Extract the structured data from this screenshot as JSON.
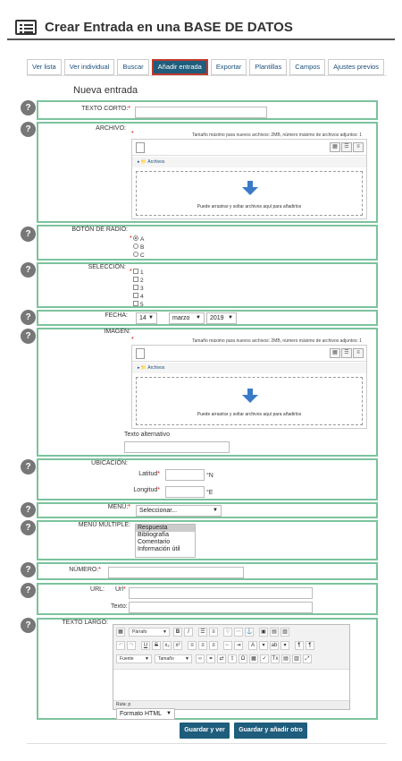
{
  "header": {
    "title": "Crear Entrada en una BASE DE DATOS",
    "icon": "list-icon"
  },
  "tabs": [
    {
      "label": "Ver lista",
      "active": false
    },
    {
      "label": "Ver individual",
      "active": false
    },
    {
      "label": "Buscar",
      "active": false
    },
    {
      "label": "Añadir entrada",
      "active": true
    },
    {
      "label": "Exportar",
      "active": false
    },
    {
      "label": "Plantillas",
      "active": false
    },
    {
      "label": "Campos",
      "active": false
    },
    {
      "label": "Ajustes previos",
      "active": false
    }
  ],
  "section_title": "Nueva entrada",
  "help_glyph": "?",
  "required_mark": "*",
  "fields": {
    "texto_corto": {
      "label": "TEXTO CORTO:",
      "value": ""
    },
    "archivo": {
      "label": "ARCHIVO:",
      "note": "Tamaño máximo para nuevos archivos: 2MB, número máximo de archivos adjuntos: 1",
      "path": "Archivos",
      "drop_text": "Puede arrastrar y soltar archivos aquí para añadirlos"
    },
    "boton_radio": {
      "label": "BOTÓN DE RADIO:",
      "options": [
        "A",
        "B",
        "C"
      ],
      "selected": "A"
    },
    "seleccion": {
      "label": "SELECCIÓN:",
      "options": [
        "1",
        "2",
        "3",
        "4",
        "5"
      ]
    },
    "fecha": {
      "label": "FECHA:",
      "day": "14",
      "month": "marzo",
      "year": "2019"
    },
    "imagen": {
      "label": "IMAGEN:",
      "note": "Tamaño máximo para nuevos archivos: 2MB, número máximo de archivos adjuntos: 1",
      "path": "Archivos",
      "drop_text": "Puede arrastrar y soltar archivos aquí para añadirlos",
      "alt_label": "Texto alternativo",
      "alt_value": ""
    },
    "ubicacion": {
      "label": "UBICACIÓN:",
      "lat_label": "Latitud",
      "lat_unit": "°N",
      "lon_label": "Longitud",
      "lon_unit": "°E"
    },
    "menu": {
      "label": "MENÚ:",
      "selected": "Seleccionar..."
    },
    "menu_multiple": {
      "label": "MENÚ MÚLTIPLE:",
      "options": [
        "Respuesta",
        "Bibliografía",
        "Comentario",
        "Información útil"
      ],
      "selected": "Respuesta"
    },
    "numero": {
      "label": "NÚMERO:",
      "value": ""
    },
    "url": {
      "label": "URL:",
      "url_label": "Url",
      "text_label": "Texto:",
      "url_value": "",
      "text_value": ""
    },
    "texto_largo": {
      "label": "TEXTO LARGO:",
      "font_family_select": "Fuente",
      "font_size_select": "Tamaño",
      "para_select": "Párrafo",
      "path": "Ruta: p",
      "format": "Formato HTML"
    }
  },
  "buttons": {
    "save_view": "Guardar y ver",
    "save_add": "Guardar y añadir otro"
  },
  "colors": {
    "accent": "#1f5d7c",
    "row_border": "#7cc39e",
    "required": "#dd0000",
    "active_tab_border": "#c0392b"
  }
}
